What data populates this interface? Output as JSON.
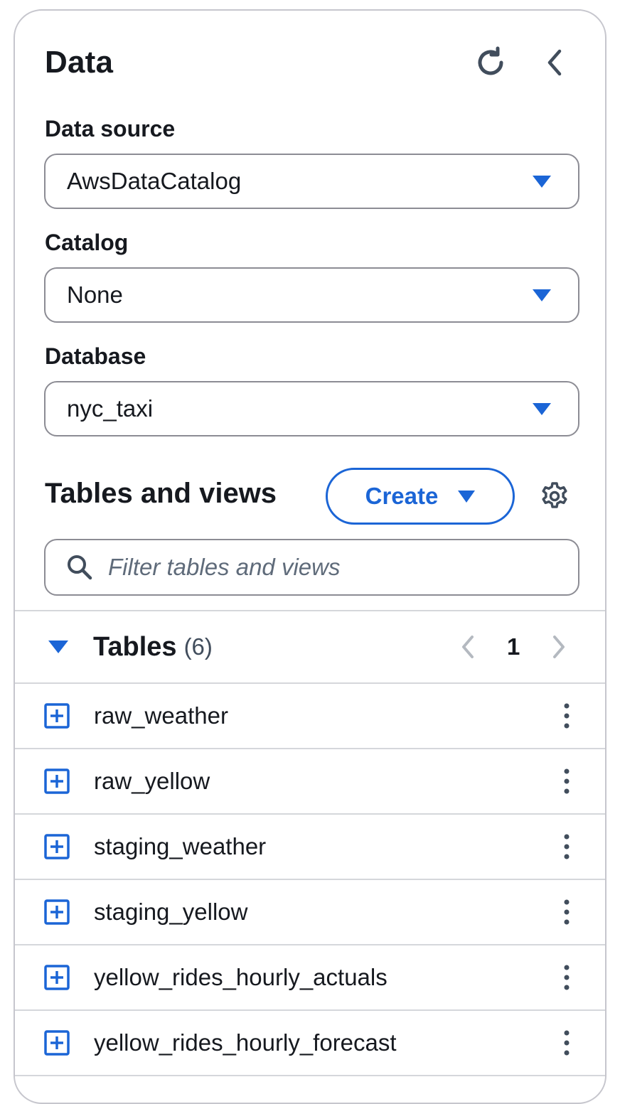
{
  "panel": {
    "title": "Data",
    "icons": {
      "refresh": "refresh-icon",
      "collapse": "chevron-left-icon"
    }
  },
  "data_source": {
    "label": "Data source",
    "value": "AwsDataCatalog"
  },
  "catalog": {
    "label": "Catalog",
    "value": "None"
  },
  "database": {
    "label": "Database",
    "value": "nyc_taxi"
  },
  "tables_and_views": {
    "title": "Tables and views",
    "create_label": "Create",
    "filter_placeholder": "Filter tables and views"
  },
  "tables": {
    "label": "Tables",
    "count": "(6)",
    "page": "1",
    "items": [
      {
        "name": "raw_weather"
      },
      {
        "name": "raw_yellow"
      },
      {
        "name": "staging_weather"
      },
      {
        "name": "staging_yellow"
      },
      {
        "name": "yellow_rides_hourly_actuals"
      },
      {
        "name": "yellow_rides_hourly_forecast"
      }
    ]
  },
  "colors": {
    "accent": "#1b65d6",
    "text": "#16191f",
    "border": "#8c8c94",
    "divider": "#d5d7db"
  }
}
